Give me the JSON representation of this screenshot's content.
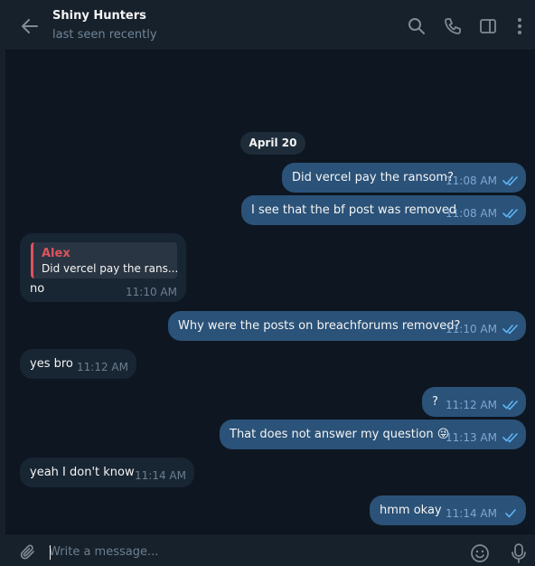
{
  "header": {
    "title": "Shiny Hunters",
    "status": "last seen recently"
  },
  "date_separator": "April 20",
  "messages": [
    {
      "dir": "out",
      "text": "Did vercel pay the ransom?",
      "time": "11:08 AM",
      "read": true
    },
    {
      "dir": "out",
      "text": "I see that the bf post was removed",
      "time": "11:08 AM",
      "read": true
    },
    {
      "dir": "in",
      "reply_to": {
        "name": "Alex",
        "text": "Did vercel pay the rans..."
      },
      "text": "no",
      "time": "11:10 AM"
    },
    {
      "dir": "out",
      "text": "Why were the posts on breachforums removed?",
      "time": "11:10 AM",
      "read": true
    },
    {
      "dir": "in",
      "text": "yes bro",
      "time": "11:12 AM"
    },
    {
      "dir": "out",
      "text": "?",
      "time": "11:12 AM",
      "read": true
    },
    {
      "dir": "out",
      "text": "That does not answer my question",
      "emoji": "😜",
      "time": "11:13 AM",
      "read": true
    },
    {
      "dir": "in",
      "text": "yeah I don't know",
      "time": "11:14 AM"
    },
    {
      "dir": "out",
      "text": "hmm okay",
      "time": "11:14 AM",
      "read": false
    }
  ],
  "composer": {
    "placeholder": "Write a message..."
  },
  "colors": {
    "background": "#0e1621",
    "header": "#17212b",
    "outgoing_bubble": "#2b5278",
    "incoming_bubble": "#182533",
    "accent": "#5eb5f7",
    "reply_accent": "#e0525e"
  },
  "icons": [
    "back-arrow-icon",
    "search-icon",
    "phone-icon",
    "sidebar-toggle-icon",
    "more-vertical-icon",
    "attach-icon",
    "emoji-icon",
    "microphone-icon",
    "double-check-icon",
    "single-check-icon"
  ]
}
